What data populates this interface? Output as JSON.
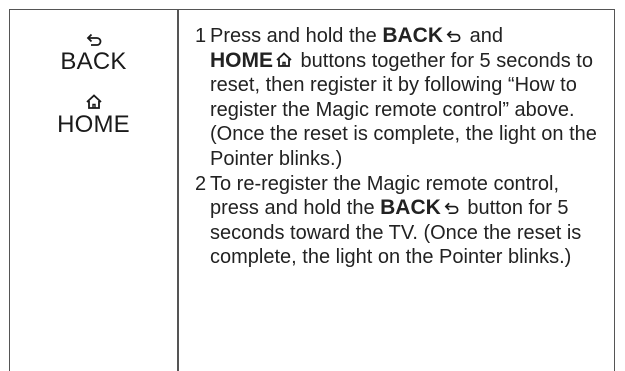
{
  "buttons": {
    "back": {
      "label": "BACK",
      "icon": "back-arrow-icon"
    },
    "home": {
      "label": "HOME",
      "icon": "home-icon"
    }
  },
  "steps": [
    {
      "number": "1",
      "text_a": "Press and hold the",
      "kw1": "BACK",
      "text_b": " and",
      "kw2": "HOME",
      "text_c": " buttons together for 5 seconds to reset, then register it by following “How to register the Magic remote control” above. (Once the reset is complete, the light on the Pointer blinks.)"
    },
    {
      "number": "2",
      "text_a": "To re-register the Magic remote control, press and hold the",
      "kw1": "BACK",
      "text_b": " button for 5 seconds toward the TV. (Once the reset is complete, the light on the Pointer blinks.)"
    }
  ]
}
